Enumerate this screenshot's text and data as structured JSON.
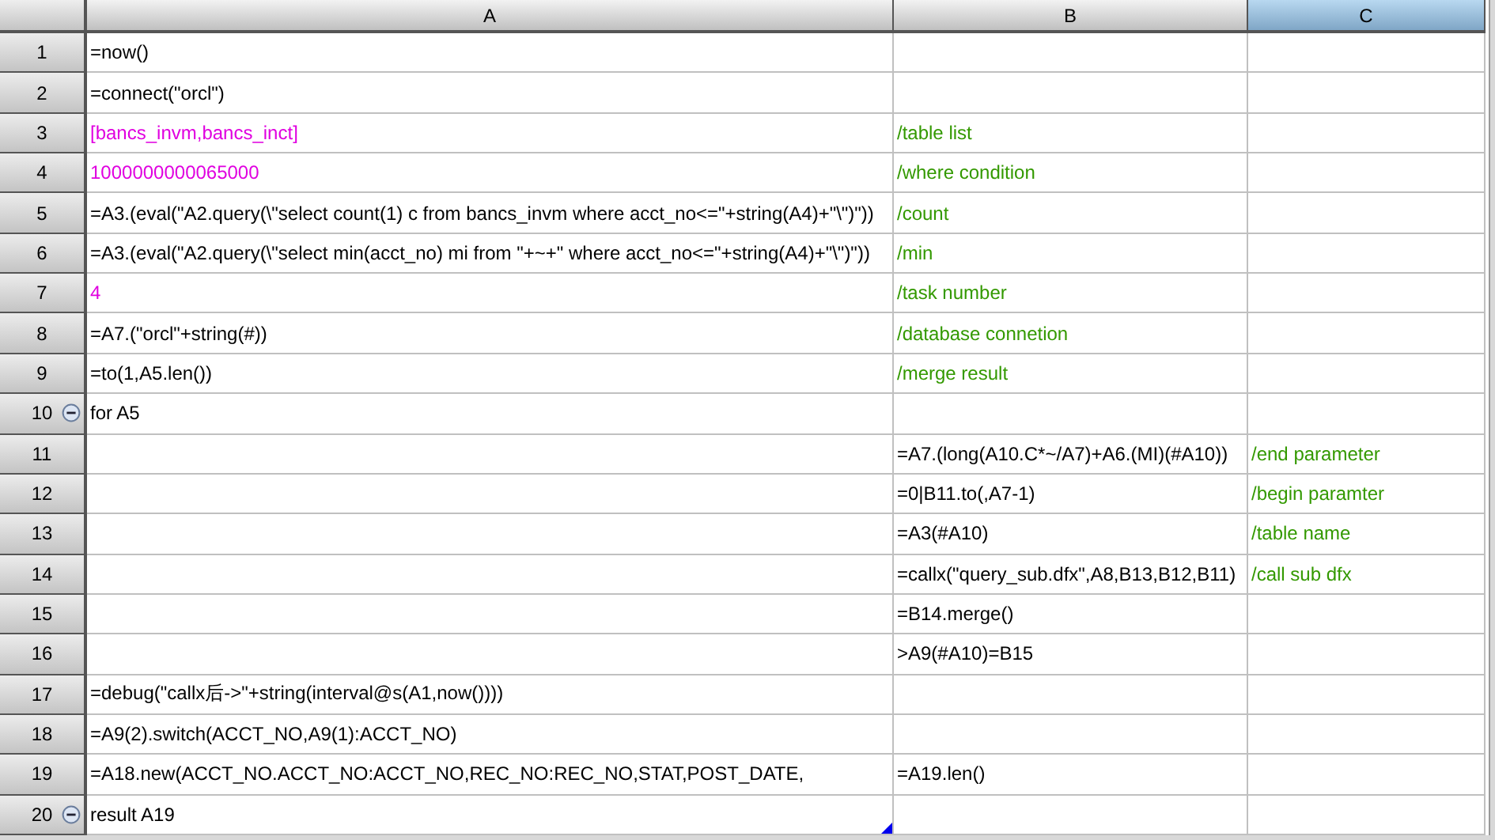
{
  "columns": [
    {
      "label": "A",
      "selected": false
    },
    {
      "label": "B",
      "selected": false
    },
    {
      "label": "C",
      "selected": true
    }
  ],
  "rows": [
    {
      "number": "1",
      "A": {
        "text": "=now()",
        "kind": "code"
      }
    },
    {
      "number": "2",
      "A": {
        "text": "=connect(\"orcl\")",
        "kind": "code"
      }
    },
    {
      "number": "3",
      "A": {
        "text": "[bancs_invm,bancs_inct]",
        "kind": "constant"
      },
      "B": {
        "text": "/table list",
        "kind": "comment"
      }
    },
    {
      "number": "4",
      "A": {
        "text": "1000000000065000",
        "kind": "constant"
      },
      "B": {
        "text": "/where condition",
        "kind": "comment"
      }
    },
    {
      "number": "5",
      "A": {
        "text": "=A3.(eval(\"A2.query(\\\"select count(1) c from bancs_invm where acct_no<=\"+string(A4)+\"\\\")\"))",
        "kind": "code"
      },
      "B": {
        "text": "/count",
        "kind": "comment"
      }
    },
    {
      "number": "6",
      "A": {
        "text": "=A3.(eval(\"A2.query(\\\"select min(acct_no) mi from \"+~+\" where acct_no<=\"+string(A4)+\"\\\")\"))",
        "kind": "code"
      },
      "B": {
        "text": "/min",
        "kind": "comment"
      }
    },
    {
      "number": "7",
      "A": {
        "text": "4",
        "kind": "constant"
      },
      "B": {
        "text": "/task number",
        "kind": "comment"
      }
    },
    {
      "number": "8",
      "A": {
        "text": "=A7.(\"orcl\"+string(#))",
        "kind": "code"
      },
      "B": {
        "text": "/database connetion",
        "kind": "comment"
      }
    },
    {
      "number": "9",
      "A": {
        "text": "=to(1,A5.len())",
        "kind": "code"
      },
      "B": {
        "text": "/merge result",
        "kind": "comment"
      }
    },
    {
      "number": "10",
      "expanded": true,
      "A": {
        "text": "for A5",
        "kind": "code"
      }
    },
    {
      "number": "11",
      "B": {
        "text": "=A7.(long(A10.C*~/A7)+A6.(MI)(#A10))",
        "kind": "code"
      },
      "C": {
        "text": "/end parameter",
        "kind": "comment"
      }
    },
    {
      "number": "12",
      "B": {
        "text": "=0|B11.to(,A7-1)",
        "kind": "code"
      },
      "C": {
        "text": "/begin paramter",
        "kind": "comment"
      }
    },
    {
      "number": "13",
      "B": {
        "text": "=A3(#A10)",
        "kind": "code"
      },
      "C": {
        "text": "/table name",
        "kind": "comment"
      }
    },
    {
      "number": "14",
      "B": {
        "text": "=callx(\"query_sub.dfx\",A8,B13,B12,B11)",
        "kind": "code"
      },
      "C": {
        "text": "/call sub dfx",
        "kind": "comment"
      }
    },
    {
      "number": "15",
      "B": {
        "text": "=B14.merge()",
        "kind": "code"
      }
    },
    {
      "number": "16",
      "B": {
        "text": ">A9(#A10)=B15",
        "kind": "code"
      }
    },
    {
      "number": "17",
      "A": {
        "text": "=debug(\"callx后->\"+string(interval@s(A1,now())))",
        "kind": "code"
      }
    },
    {
      "number": "18",
      "A": {
        "text": "=A9(2).switch(ACCT_NO,A9(1):ACCT_NO)",
        "kind": "code"
      }
    },
    {
      "number": "19",
      "A": {
        "text": "=A18.new(ACCT_NO.ACCT_NO:ACCT_NO,REC_NO:REC_NO,STAT,POST_DATE,",
        "kind": "code"
      },
      "B": {
        "text": "=A19.len()",
        "kind": "code"
      }
    },
    {
      "number": "20",
      "expanded": true,
      "A": {
        "text": "result A19",
        "kind": "code"
      }
    }
  ]
}
